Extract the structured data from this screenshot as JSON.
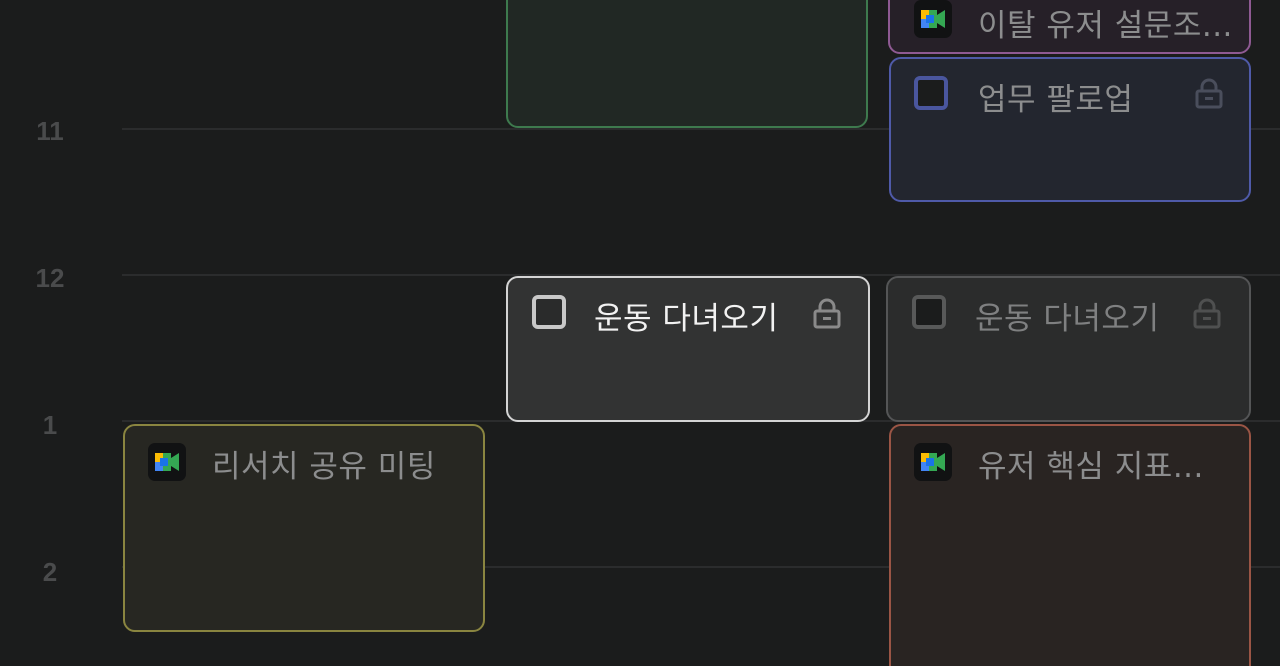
{
  "timeline": {
    "hours": [
      "11",
      "12",
      "1",
      "2"
    ]
  },
  "events": {
    "green_block": {},
    "churn_survey": {
      "title": "이탈 유저 설문조...",
      "icon": "google-meet-icon",
      "border": "#8f5a93",
      "bg": "#262028"
    },
    "work_followup": {
      "title": "업무 팔로업",
      "icon": "checkbox-icon",
      "locked": true,
      "border": "#4f5aa8",
      "bg": "#23262f"
    },
    "exercise_selected": {
      "title": "운동 다녀오기",
      "icon": "checkbox-icon",
      "locked": true,
      "selected": true,
      "border": "#d4d4d4",
      "bg": "#323333"
    },
    "exercise": {
      "title": "운동 다녀오기",
      "icon": "checkbox-icon",
      "locked": true,
      "border": "#545556",
      "bg": "#2b2c2c"
    },
    "research_share": {
      "title": "리서치 공유 미팅",
      "icon": "google-meet-icon",
      "border": "#8a8540",
      "bg": "#272722"
    },
    "user_metrics": {
      "title": "유저 핵심 지표...",
      "icon": "google-meet-icon",
      "border": "#9a5545",
      "bg": "#292422"
    }
  },
  "colors": {
    "background": "#1b1c1c",
    "hour_label": "#4a4b4c",
    "text_dim": "#8c8d8e",
    "text_bright": "#f2f2f2"
  }
}
